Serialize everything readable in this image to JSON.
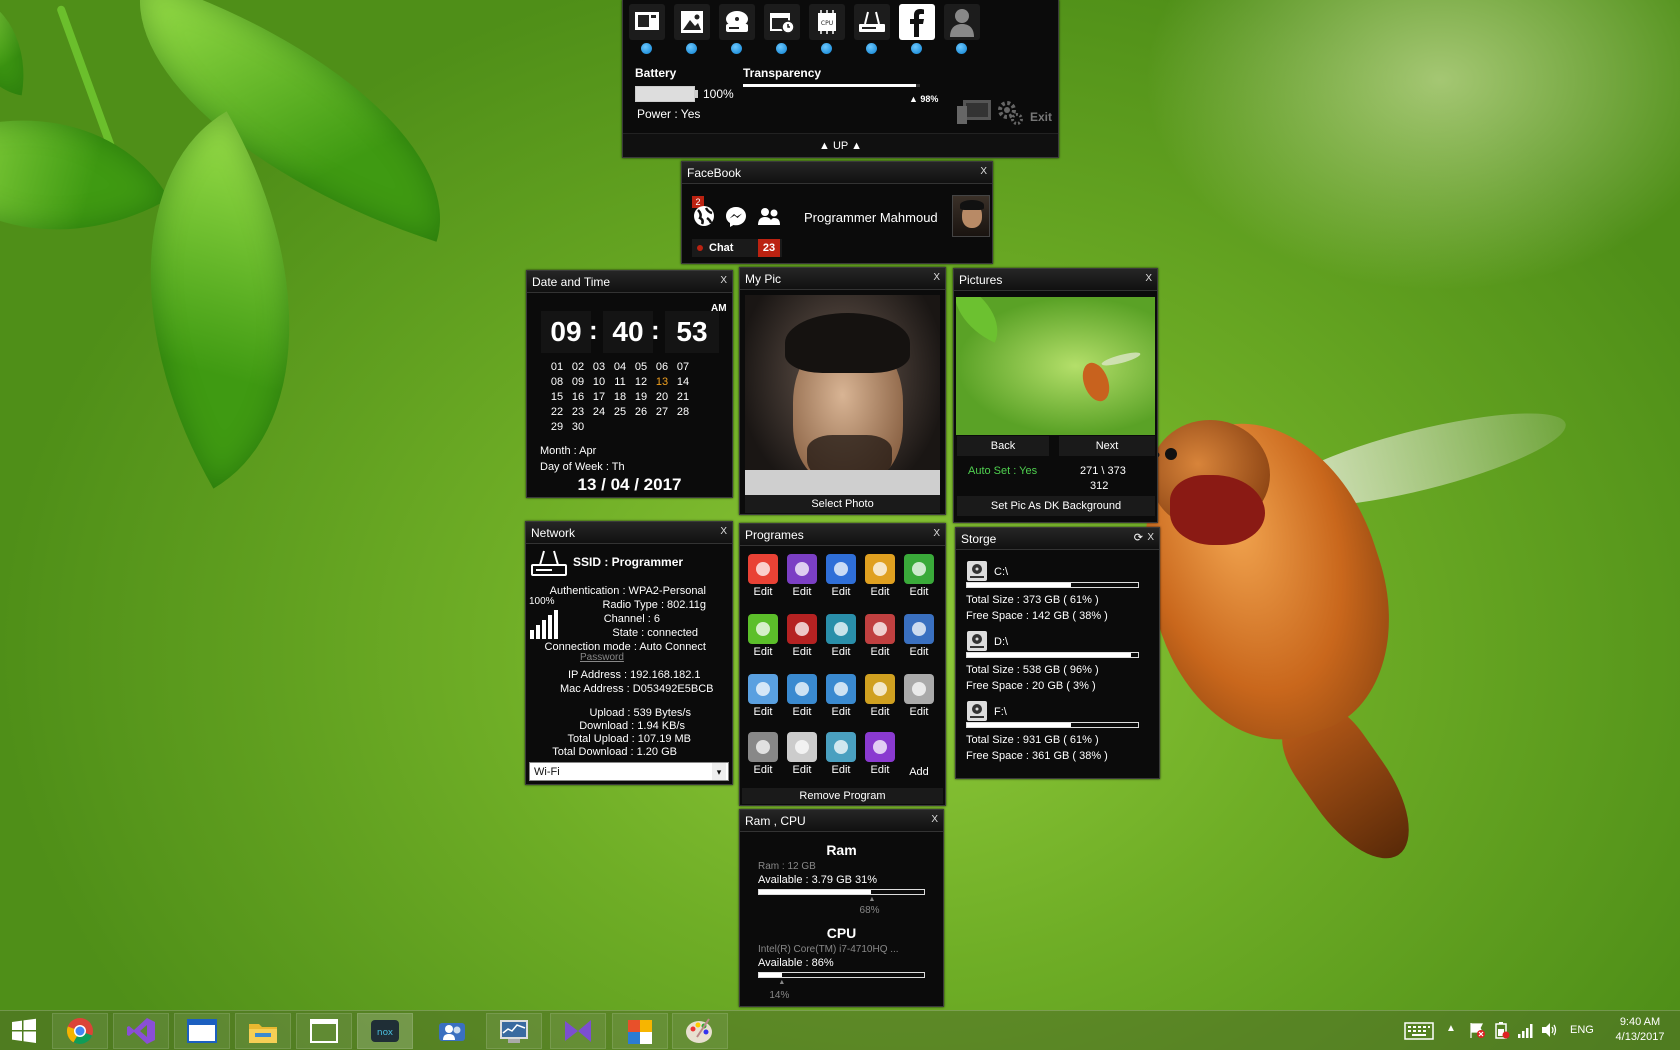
{
  "toolbar": {
    "icons": [
      "display-icon",
      "picture-icon",
      "drive-icon",
      "calendar-clock-icon",
      "cpu-icon",
      "router-icon",
      "facebook-icon",
      "user-icon"
    ],
    "cpu_text": "CPU",
    "battery_label": "Battery",
    "battery_percent": "100%",
    "battery_level": 1.0,
    "power_text": "Power : Yes",
    "transparency_label": "Transparency",
    "transparency_value": "98%",
    "transparency_level": 0.98,
    "exit_label": "Exit",
    "up_label": "▲ UP ▲"
  },
  "facebook": {
    "title": "FaceBook",
    "close": "X",
    "notif_count": "2",
    "user_name": "Programmer Mahmoud",
    "chat_label": "Chat",
    "chat_count": "23"
  },
  "datetime": {
    "title": "Date and Time",
    "close": "X",
    "hours": "09",
    "minutes": "40",
    "seconds": "53",
    "ampm": "AM",
    "days": [
      "01",
      "02",
      "03",
      "04",
      "05",
      "06",
      "07",
      "08",
      "09",
      "10",
      "11",
      "12",
      "13",
      "14",
      "15",
      "16",
      "17",
      "18",
      "19",
      "20",
      "21",
      "22",
      "23",
      "24",
      "25",
      "26",
      "27",
      "28",
      "29",
      "30"
    ],
    "today": "13",
    "month_text": "Month : Apr",
    "dow_text": "Day of Week : Th",
    "date": "13 / 04 / 2017"
  },
  "mypic": {
    "title": "My Pic",
    "close": "X",
    "select_label": "Select Photo"
  },
  "pictures": {
    "title": "Pictures",
    "close": "X",
    "back_label": "Back",
    "next_label": "Next",
    "auto_set": "Auto Set : Yes",
    "counter": "271 \\ 373",
    "counter2": "312",
    "set_bg_label": "Set Pic As DK Background"
  },
  "network": {
    "title": "Network",
    "close": "X",
    "ssid": "SSID : Programmer",
    "signal": "100%",
    "lines_top": [
      "Authentication : WPA2-Personal",
      "Radio Type : 802.11g",
      "Channel : 6",
      "State : connected",
      "Connection mode : Auto Connect"
    ],
    "password_label": "Password",
    "ip": "IP Address : 192.168.182.1",
    "mac": "Mac Address : D053492E5BCB",
    "upload": "Upload : 539 Bytes/s",
    "download": "Download : 1.94 KB/s",
    "total_upload": "Total Upload : 107.19 MB",
    "total_download": "Total Download : 1.20 GB",
    "adapter": "Wi-Fi"
  },
  "programs": {
    "title": "Programes",
    "close": "X",
    "edit_label": "Edit",
    "add_label": "Add",
    "remove_label": "Remove Program",
    "items": [
      {
        "icon": "chrome-icon",
        "color": "#e94235"
      },
      {
        "icon": "visual-studio-icon",
        "color": "#7b3fc4"
      },
      {
        "icon": "window-icon",
        "color": "#2f6fd8"
      },
      {
        "icon": "folder-app-icon",
        "color": "#e0a020"
      },
      {
        "icon": "search-app-icon",
        "color": "#3aaa3a"
      },
      {
        "icon": "green-disc-icon",
        "color": "#5cbf2a"
      },
      {
        "icon": "anonymous-icon",
        "color": "#b52222"
      },
      {
        "icon": "shield-app-icon",
        "color": "#2a8faa"
      },
      {
        "icon": "file-app-icon",
        "color": "#c04040"
      },
      {
        "icon": "people-app-icon",
        "color": "#3a70c0"
      },
      {
        "icon": "cube-icon",
        "color": "#5aa0e0"
      },
      {
        "icon": "blueprint-icon",
        "color": "#3a8ad0"
      },
      {
        "icon": "pencil-blueprint-icon",
        "color": "#3a8ad0"
      },
      {
        "icon": "globe-app-icon",
        "color": "#d0a020"
      },
      {
        "icon": "gem-icon",
        "color": "#aaaaaa"
      },
      {
        "icon": "ironman-icon",
        "color": "#888888"
      },
      {
        "icon": "window-frame-icon",
        "color": "#cccccc"
      },
      {
        "icon": "nox-icon",
        "color": "#4aa0c0"
      },
      {
        "icon": "star-app-icon",
        "color": "#8a3ad0"
      }
    ]
  },
  "storage": {
    "title": "Storge",
    "close": "X",
    "drives": [
      {
        "name": "C:\\",
        "used": 0.61,
        "total": "Total Size : 373 GB  ( 61% )",
        "free": "Free Space : 142 GB  ( 38% )"
      },
      {
        "name": "D:\\",
        "used": 0.96,
        "total": "Total Size : 538 GB  ( 96% )",
        "free": "Free Space : 20 GB  ( 3% )"
      },
      {
        "name": "F:\\",
        "used": 0.61,
        "total": "Total Size : 931 GB  ( 61% )",
        "free": "Free Space : 361 GB  ( 38% )"
      }
    ]
  },
  "ramcpu": {
    "title": "Ram , CPU",
    "close": "X",
    "ram_heading": "Ram",
    "ram_total": "Ram : 12 GB",
    "ram_available": "Available : 3.79 GB   31%",
    "ram_used_pct": "68%",
    "ram_used": 0.68,
    "cpu_heading": "CPU",
    "cpu_name": "Intel(R) Core(TM) i7-4710HQ ...",
    "cpu_available": "Available : 86%",
    "cpu_used_pct": "14%",
    "cpu_used": 0.14
  },
  "taskbar": {
    "lang": "ENG",
    "time": "9:40 AM",
    "date": "4/13/2017"
  }
}
